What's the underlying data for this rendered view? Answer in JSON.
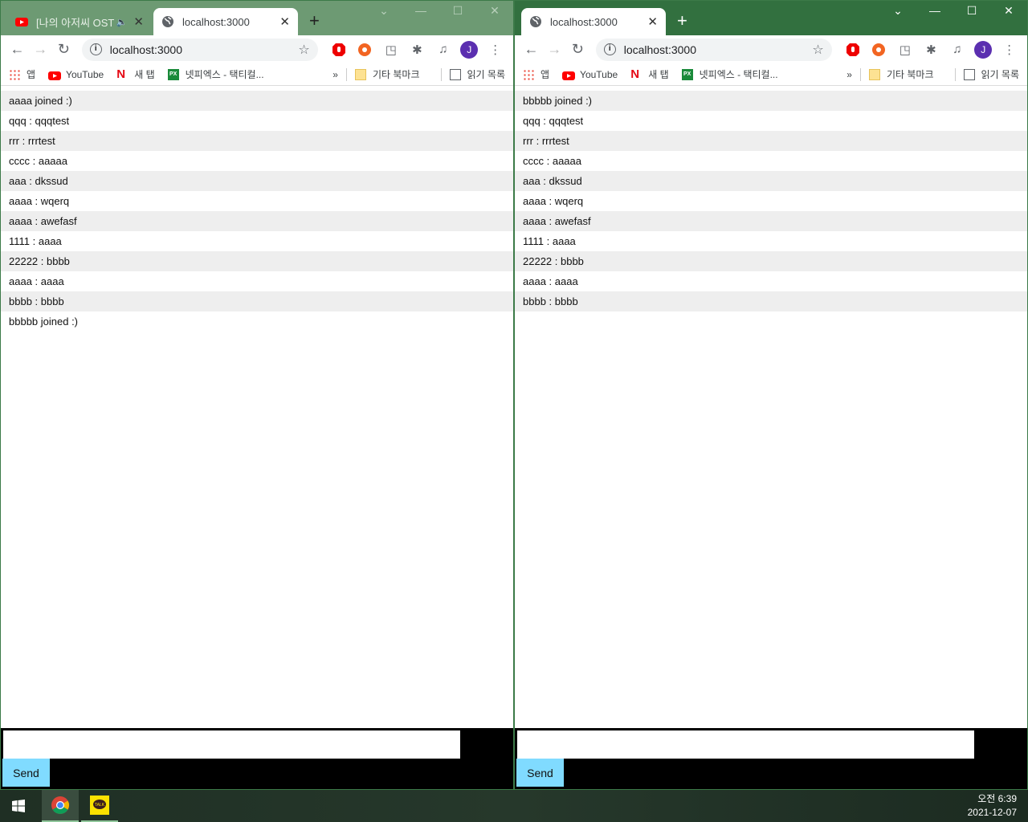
{
  "windows": [
    {
      "side": "left",
      "tabs": [
        {
          "label": "[나의 아저씨 OST",
          "icon": "youtube-icon",
          "active": false,
          "audio": true
        },
        {
          "label": "localhost:3000",
          "icon": "globe-icon",
          "active": true
        }
      ],
      "url": "localhost:3000",
      "messages": [
        "aaaa joined :)",
        "qqq : qqqtest",
        "rrr : rrrtest",
        "cccc : aaaaa",
        "aaa : dkssud",
        "aaaa : wqerq",
        "aaaa : awefasf",
        "1111 : aaaa",
        "22222 : bbbb",
        "aaaa : aaaa",
        "bbbb : bbbb",
        "bbbbb joined :)"
      ],
      "input_value": "",
      "send_label": "Send"
    },
    {
      "side": "right",
      "tabs": [
        {
          "label": "localhost:3000",
          "icon": "globe-icon",
          "active": true
        }
      ],
      "url": "localhost:3000",
      "messages": [
        "bbbbb joined :)",
        "qqq : qqqtest",
        "rrr : rrrtest",
        "cccc : aaaaa",
        "aaa : dkssud",
        "aaaa : wqerq",
        "aaaa : awefasf",
        "1111 : aaaa",
        "22222 : bbbb",
        "aaaa : aaaa",
        "bbbb : bbbb"
      ],
      "input_value": "",
      "send_label": "Send"
    }
  ],
  "bookmarks": {
    "apps": "앱",
    "youtube": "YouTube",
    "newtab": "새 탭",
    "px": "넷피엑스 - 택티컬...",
    "more": "»",
    "other": "기타 북마크",
    "reading": "읽기 목록"
  },
  "profile_initial": "J",
  "taskbar": {
    "time": "오전 6:39",
    "date": "2021-12-07"
  },
  "colors": {
    "send_button": "#80dbff",
    "active_titlebar": "#32703f",
    "inactive_titlebar": "#6d9a73"
  }
}
